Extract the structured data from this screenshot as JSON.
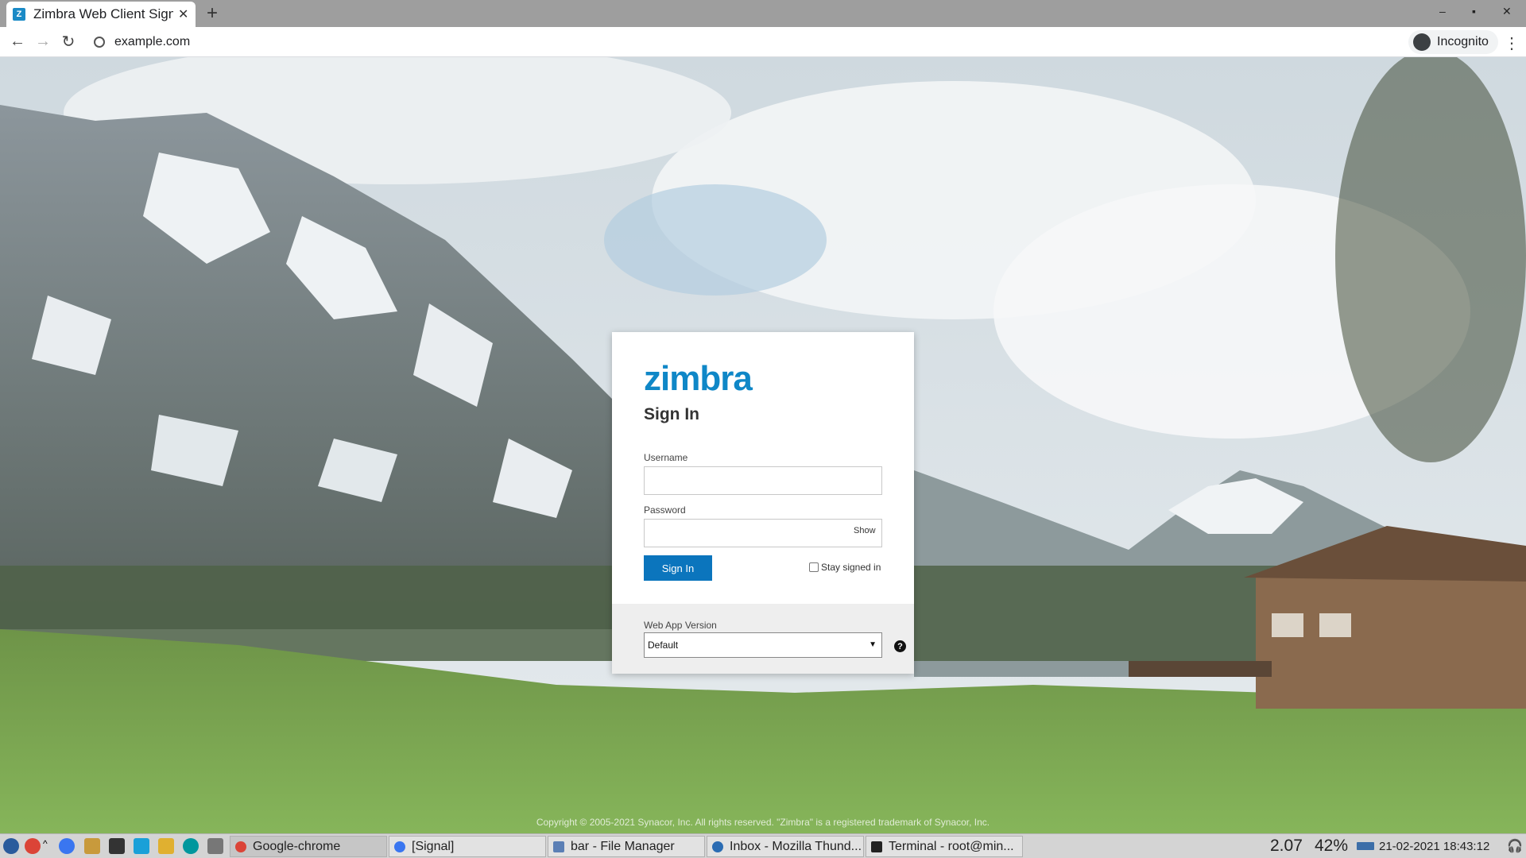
{
  "browser": {
    "tab_title": "Zimbra Web Client Sign In",
    "tab_favicon": "Z",
    "new_tab_symbol": "+",
    "url": "example.com",
    "incognito_label": "Incognito"
  },
  "login": {
    "logo": "zimbra",
    "heading": "Sign In",
    "username_label": "Username",
    "username_value": "",
    "password_label": "Password",
    "password_value": "",
    "show_label": "Show",
    "signin_label": "Sign In",
    "stay_signed_in_label": "Stay signed in",
    "stay_signed_in_checked": false,
    "web_app_version_label": "Web App Version",
    "web_app_version_value": "Default",
    "help_symbol": "?"
  },
  "footer": {
    "copyright": "Copyright © 2005-2021 Synacor, Inc. All rights reserved. \"Zimbra\" is a registered trademark of Synacor, Inc."
  },
  "taskbar": {
    "tasks": [
      {
        "label": "Google-chrome",
        "icon": "chrome-icon"
      },
      {
        "label": "[Signal]",
        "icon": "signal-icon"
      },
      {
        "label": "bar - File Manager",
        "icon": "folder-icon"
      },
      {
        "label": "Inbox - Mozilla Thund...",
        "icon": "thunderbird-icon"
      },
      {
        "label": "Terminal - root@min...",
        "icon": "terminal-icon"
      }
    ],
    "load": "2.07",
    "battery": "42%",
    "clock": "21-02-2021 18:43:12"
  },
  "colors": {
    "brand": "#0f87c7",
    "button": "#0b75bd"
  }
}
